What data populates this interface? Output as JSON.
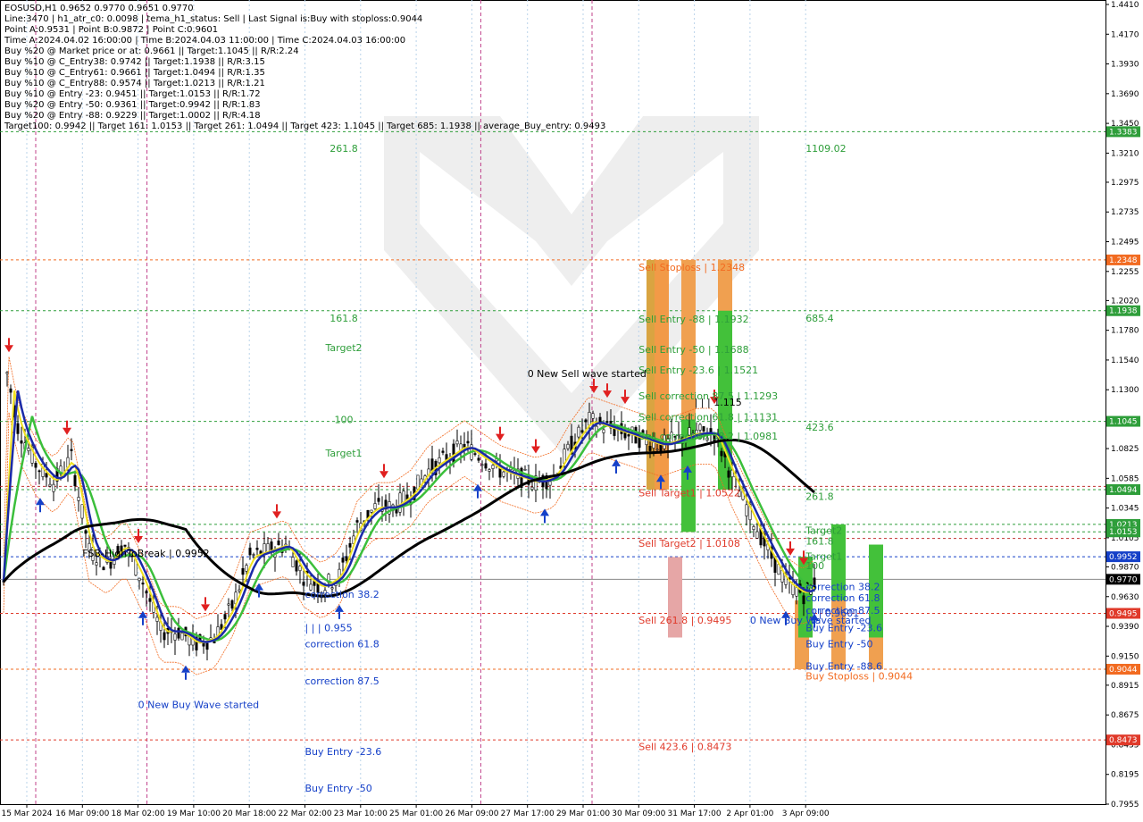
{
  "header": {
    "lines": [
      "EOSUSD,H1  0.9652 0.9770 0.9651 0.9770",
      "Line:3470 | h1_atr_c0: 0.0098 | tema_h1_status: Sell | Last Signal is:Buy with stoploss:0.9044",
      "Point A:0.9531 | Point B:0.9872 | Point C:0.9601",
      "Time A:2024.04.02 16:00:00 | Time B:2024.04.03 11:00:00 | Time C:2024.04.03 16:00:00",
      "Buy %20 @ Market price or at: 0.9661 || Target:1.1045 || R/R:2.24",
      "Buy %10 @ C_Entry38: 0.9742 || Target:1.1938 || R/R:3.15",
      "Buy %10 @ C_Entry61: 0.9661 || Target:1.0494 || R/R:1.35",
      "Buy %10 @ C_Entry88: 0.9574 || Target:1.0213 || R/R:1.21",
      "Buy %10 @ Entry -23: 0.9451 || Target:1.0153 || R/R:1.72",
      "Buy %20 @ Entry -50: 0.9361 || Target:0.9942 || R/R:1.83",
      "Buy %20 @ Entry -88: 0.9229 || Target:1.0002 || R/R:4.18",
      "Target100: 0.9942 || Target 161: 1.0153 || Target 261: 1.0494 || Target 423: 1.1045 || Target 685: 1.1938 || average_Buy_entry: 0.9493"
    ]
  },
  "chart_data": {
    "type": "candlestick",
    "symbol": "EOSUSD",
    "timeframe": "H1",
    "ylim": [
      0.7955,
      1.441
    ],
    "y_ticks": [
      1.441,
      1.417,
      1.393,
      1.369,
      1.345,
      1.321,
      1.2975,
      1.2735,
      1.2495,
      1.2255,
      1.202,
      1.178,
      1.154,
      1.13,
      1.106,
      1.0825,
      1.0585,
      1.0345,
      1.0105,
      0.987,
      0.963,
      0.939,
      0.915,
      0.8915,
      0.8675,
      0.8435,
      0.8195,
      0.7955
    ],
    "x_ticks": [
      "15 Mar 2024",
      "16 Mar 09:00",
      "18 Mar 02:00",
      "19 Mar 10:00",
      "20 Mar 18:00",
      "22 Mar 02:00",
      "23 Mar 10:00",
      "25 Mar 01:00",
      "26 Mar 09:00",
      "27 Mar 17:00",
      "29 Mar 01:00",
      "30 Mar 09:00",
      "31 Mar 17:00",
      "2 Apr 01:00",
      "3 Apr 09:00"
    ],
    "current_price": 0.977,
    "price_badges": [
      {
        "value": "1.3383",
        "color": "#2e9e3a"
      },
      {
        "value": "1.2348",
        "color": "#f26b21"
      },
      {
        "value": "1.1938",
        "color": "#2e9e3a"
      },
      {
        "value": "1.1045",
        "color": "#2e9e3a"
      },
      {
        "value": "1.0494",
        "color": "#2e9e3a"
      },
      {
        "value": "1.0213",
        "color": "#2e9e3a"
      },
      {
        "value": "1.0153",
        "color": "#2e9e3a"
      },
      {
        "value": "0.9952",
        "color": "#1540c8"
      },
      {
        "value": "0.9770",
        "color": "#000000"
      },
      {
        "value": "0.9495",
        "color": "#e03a2a"
      },
      {
        "value": "0.9044",
        "color": "#f26b21"
      },
      {
        "value": "0.8473",
        "color": "#e03a2a"
      }
    ],
    "h_levels": [
      {
        "y": 1.3383,
        "color": "#2e9e3a",
        "style": "dash"
      },
      {
        "y": 1.2348,
        "color": "#f26b21",
        "style": "dash"
      },
      {
        "y": 1.1938,
        "color": "#2e9e3a",
        "style": "dash"
      },
      {
        "y": 1.1045,
        "color": "#2e9e3a",
        "style": "dash"
      },
      {
        "y": 1.052,
        "color": "#c03030",
        "style": "dash"
      },
      {
        "y": 1.0494,
        "color": "#2e9e3a",
        "style": "dash"
      },
      {
        "y": 1.0213,
        "color": "#2e9e3a",
        "style": "dash"
      },
      {
        "y": 1.0153,
        "color": "#2e9e3a",
        "style": "dash"
      },
      {
        "y": 1.01,
        "color": "#c03030",
        "style": "dash"
      },
      {
        "y": 0.9952,
        "color": "#1540c8",
        "style": "dash"
      },
      {
        "y": 0.977,
        "color": "#888888",
        "style": "solid"
      },
      {
        "y": 0.9495,
        "color": "#e03a2a",
        "style": "dash"
      },
      {
        "y": 0.9044,
        "color": "#f26b21",
        "style": "dash"
      },
      {
        "y": 0.8473,
        "color": "#e03a2a",
        "style": "dash"
      }
    ],
    "v_lines": [
      {
        "x": "15 Mar 2024",
        "color": "#c0408a"
      },
      {
        "x": "18 Mar 02:00",
        "color": "#c0408a"
      },
      {
        "x": "26 Mar 09:00",
        "color": "#c0408a"
      },
      {
        "x": "29 Mar 01:00",
        "color": "#c0408a"
      }
    ],
    "annotations": [
      {
        "text": "261.8",
        "color": "#2e9e3a",
        "x": "19 Mar 10:00",
        "y": 1.325
      },
      {
        "text": "161.8",
        "color": "#2e9e3a",
        "x": "19 Mar 10:00",
        "y": 1.188
      },
      {
        "text": "Target2",
        "color": "#2e9e3a",
        "x": "19 Mar 10:00",
        "y": 1.164
      },
      {
        "text": "100",
        "color": "#2e9e3a",
        "x": "19 Mar 10:00",
        "y": 1.106
      },
      {
        "text": "Target1",
        "color": "#2e9e3a",
        "x": "19 Mar 10:00",
        "y": 1.079
      },
      {
        "text": "FSB-HighToBreak | 0.9952",
        "color": "#000000",
        "x": "16 Mar 09:00",
        "y": 0.998
      },
      {
        "text": "correction 38.2",
        "color": "#1540c8",
        "x": "22 Mar 02:00",
        "y": 0.965
      },
      {
        "text": "| | | 0.955",
        "color": "#1540c8",
        "x": "22 Mar 02:00",
        "y": 0.938
      },
      {
        "text": "correction 61.8",
        "color": "#1540c8",
        "x": "22 Mar 02:00",
        "y": 0.925
      },
      {
        "text": "correction 87.5",
        "color": "#1540c8",
        "x": "22 Mar 02:00",
        "y": 0.895
      },
      {
        "text": "0 New Buy Wave started",
        "color": "#1540c8",
        "x": "18 Mar 02:00",
        "y": 0.876
      },
      {
        "text": "Buy Entry -23.6",
        "color": "#1540c8",
        "x": "22 Mar 02:00",
        "y": 0.838
      },
      {
        "text": "Buy Entry -50",
        "color": "#1540c8",
        "x": "22 Mar 02:00",
        "y": 0.8085
      },
      {
        "text": "Sell Stoploss | 1.2348",
        "color": "#f26b21",
        "x": "30 Mar 09:00",
        "y": 1.229
      },
      {
        "text": "Sell Entry -88 | 1.1932",
        "color": "#2e9e3a",
        "x": "30 Mar 09:00",
        "y": 1.187
      },
      {
        "text": "Sell Entry -50 | 1.1688",
        "color": "#2e9e3a",
        "x": "30 Mar 09:00",
        "y": 1.1625
      },
      {
        "text": "Sell Entry -23.6 | 1.1521",
        "color": "#2e9e3a",
        "x": "30 Mar 09:00",
        "y": 1.146
      },
      {
        "text": "0 New Sell wave started",
        "color": "#000000",
        "x": "27 Mar 17:00",
        "y": 1.143
      },
      {
        "text": "Sell correction 87.5 | 1.1293",
        "color": "#2e9e3a",
        "x": "30 Mar 09:00",
        "y": 1.125
      },
      {
        "text": "| | | 1.115",
        "color": "#000000",
        "x": "31 Mar 17:00",
        "y": 1.12
      },
      {
        "text": "Sell correction 61.8 | 1.1131",
        "color": "#2e9e3a",
        "x": "30 Mar 09:00",
        "y": 1.108
      },
      {
        "text": "Sell correction 38.2 | 1.0981",
        "color": "#2e9e3a",
        "x": "30 Mar 09:00",
        "y": 1.0925
      },
      {
        "text": "Sell Target1 | 1.0522",
        "color": "#e03a2a",
        "x": "30 Mar 09:00",
        "y": 1.047
      },
      {
        "text": "Sell Target2 | 1.0108",
        "color": "#e03a2a",
        "x": "30 Mar 09:00",
        "y": 1.006
      },
      {
        "text": "Sell 261.8 | 0.9495",
        "color": "#e03a2a",
        "x": "30 Mar 09:00",
        "y": 0.944
      },
      {
        "text": "Sell 423.6 | 0.8473",
        "color": "#e03a2a",
        "x": "30 Mar 09:00",
        "y": 0.842
      },
      {
        "text": "0 New Buy Wave started",
        "color": "#1540c8",
        "x": "2 Apr 01:00",
        "y": 0.944
      },
      {
        "text": "| | | 0.9601",
        "color": "#1540c8",
        "x": "3 Apr 09:00",
        "y": 0.95
      },
      {
        "text": "Buy Stoploss | 0.9044",
        "color": "#f26b21",
        "x": "3 Apr 09:00",
        "y": 0.899
      },
      {
        "text": "1109.02",
        "color": "#2e9e3a",
        "x": "3 Apr 09:00",
        "y": 1.325
      },
      {
        "text": "685.4",
        "color": "#2e9e3a",
        "x": "3 Apr 09:00",
        "y": 1.188
      },
      {
        "text": "423.6",
        "color": "#2e9e3a",
        "x": "3 Apr 09:00",
        "y": 1.1
      },
      {
        "text": "261.8",
        "color": "#2e9e3a",
        "x": "3 Apr 09:00",
        "y": 1.044
      },
      {
        "text": "Target2",
        "color": "#2e9e3a",
        "x": "3 Apr 09:00",
        "y": 1.0165
      },
      {
        "text": "161.8",
        "color": "#2e9e3a",
        "x": "3 Apr 09:00",
        "y": 1.008
      },
      {
        "text": "Target1",
        "color": "#2e9e3a",
        "x": "3 Apr 09:00",
        "y": 0.9955
      },
      {
        "text": "100",
        "color": "#2e9e3a",
        "x": "3 Apr 09:00",
        "y": 0.988
      },
      {
        "text": "correction 38.2",
        "color": "#1540c8",
        "x": "3 Apr 09:00",
        "y": 0.971
      },
      {
        "text": "correction 61.8",
        "color": "#1540c8",
        "x": "3 Apr 09:00",
        "y": 0.962
      },
      {
        "text": "correction 87.5",
        "color": "#1540c8",
        "x": "3 Apr 09:00",
        "y": 0.952
      },
      {
        "text": "Buy Entry -23.6",
        "color": "#1540c8",
        "x": "3 Apr 09:00",
        "y": 0.938
      },
      {
        "text": "Buy Entry -50",
        "color": "#1540c8",
        "x": "3 Apr 09:00",
        "y": 0.925
      },
      {
        "text": "Buy Entry -88.6",
        "color": "#1540c8",
        "x": "3 Apr 09:00",
        "y": 0.907
      }
    ],
    "colors": {
      "ma_fast": "#1a2aa8",
      "ma_signal": "#f0e020",
      "ma_mid": "#3bbf3b",
      "ma_slow": "#000000",
      "envelope": "#f26b21",
      "candle": "#000000"
    }
  }
}
